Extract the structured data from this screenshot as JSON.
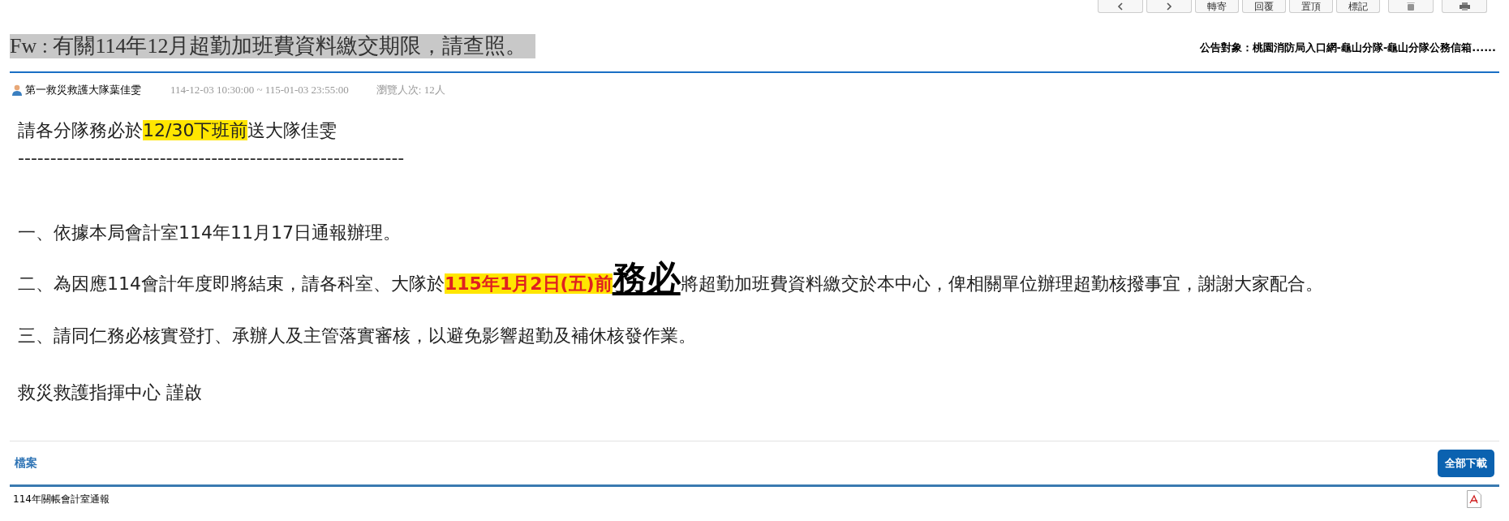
{
  "toolbar": [
    {
      "kind": "prev"
    },
    {
      "kind": "next"
    },
    {
      "kind": "text",
      "label": "轉寄"
    },
    {
      "kind": "text",
      "label": "回覆"
    },
    {
      "kind": "text",
      "label": "置頂"
    },
    {
      "kind": "text",
      "label": "標記"
    },
    {
      "kind": "trash"
    },
    {
      "kind": "print"
    }
  ],
  "title": "Fw : 有關114年12月超勤加班費資料繳交期限，請查照。",
  "audience": "公告對象：桃園消防局入口網-龜山分隊-龜山分隊公務信箱......",
  "meta": {
    "author": "第一救災救護大隊葉佳雯",
    "period": "114-12-03 10:30:00 ~ 115-01-03 23:55:00",
    "views": "瀏覽人次: 12人"
  },
  "body": [
    {
      "segments": [
        {
          "kind": "plain",
          "text": "請各分隊務必於"
        },
        {
          "kind": "highlight",
          "text": "12/30下班前"
        },
        {
          "kind": "plain",
          "text": "送大隊佳雯"
        }
      ]
    },
    {
      "segments": [
        {
          "kind": "plain",
          "text": "------------------------------------------------------------"
        }
      ]
    },
    {
      "segments": [
        {
          "kind": "plain",
          "text": "一、依據本局會計室114年11月17日通報辦理。"
        }
      ]
    },
    {
      "segments": [
        {
          "kind": "plain",
          "text": "二、為因應114會計年度即將結束，請各科室、大隊於"
        },
        {
          "kind": "urgent",
          "text": "115年1月2日(五)前"
        },
        {
          "kind": "emphasis",
          "text": "務必"
        },
        {
          "kind": "plain",
          "text": "將超勤加班費資料繳交於本中心，俾相關單位辦理超勤核撥事宜，謝謝大家配合。"
        }
      ]
    },
    {
      "segments": [
        {
          "kind": "plain",
          "text": "三、請同仁務必核實登打、承辦人及主管落實審核，以避免影響超勤及補休核發作業。"
        }
      ]
    },
    {
      "segments": [
        {
          "kind": "plain",
          "text": "救災救護指揮中心 謹啟"
        }
      ]
    }
  ],
  "files": {
    "heading": "檔案",
    "download_all": "全部下載",
    "items": [
      {
        "name": "114年關帳會計室通報"
      }
    ]
  }
}
